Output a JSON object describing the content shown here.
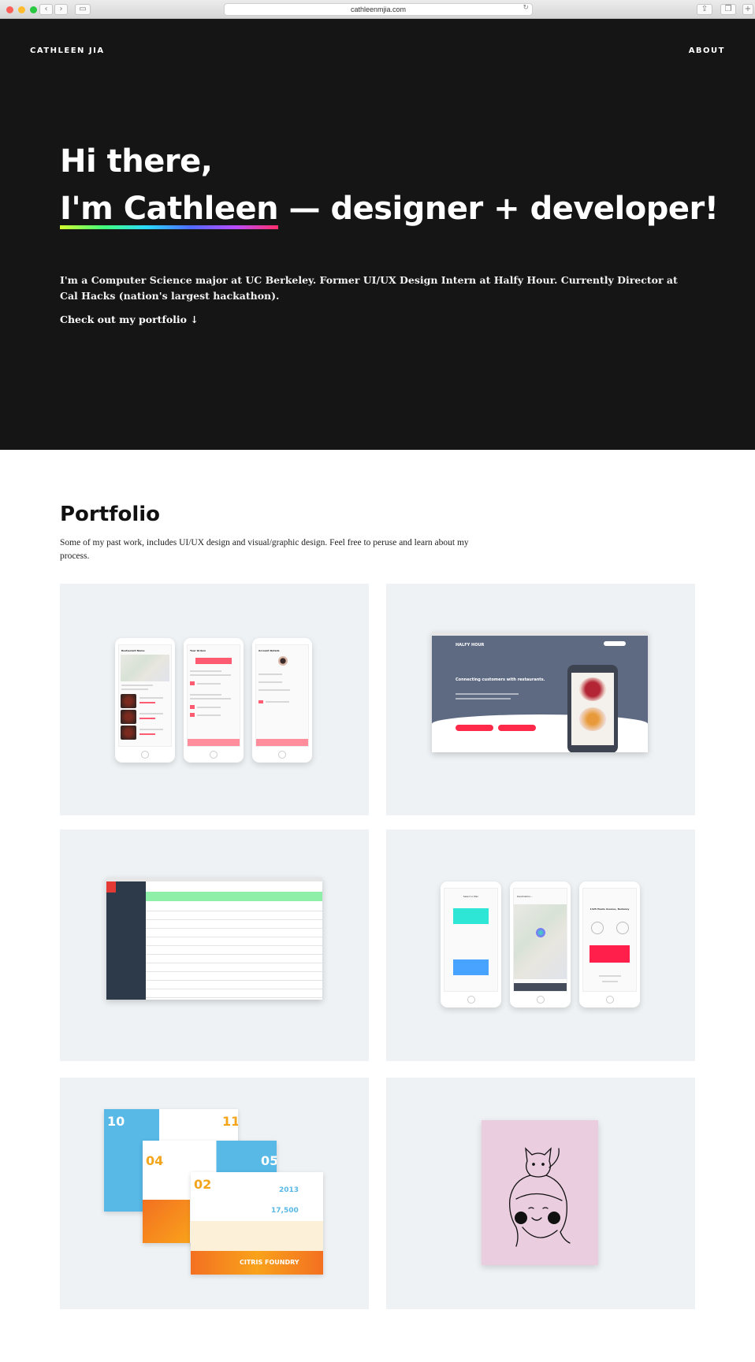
{
  "browser": {
    "url": "cathleenmjia.com"
  },
  "nav": {
    "brand": "CATHLEEN JIA",
    "about": "ABOUT"
  },
  "hero": {
    "greeting": "Hi there,",
    "name": "I'm Cathleen",
    "tagline": " — designer + developer!",
    "intro": "I'm a Computer Science major at UC Berkeley. Former UI/UX Design Intern at Halfy Hour. Currently Director at Cal Hacks (nation's largest hackathon).",
    "cta": "Check out my portfolio ↓"
  },
  "portfolio": {
    "title": "Portfolio",
    "description": "Some of my past work, includes UI/UX design and visual/graphic design. Feel free to peruse and learn about my process.",
    "items": [
      {
        "label": "Halfy Hour mobile app",
        "screens": [
          "Restaurant Name",
          "Your Orders",
          "Account Details"
        ]
      },
      {
        "label": "Halfy Hour website",
        "brand": "HALFY HOUR",
        "headline": "Connecting customers with restaurants."
      },
      {
        "label": "Dashboard table"
      },
      {
        "label": "Transport app",
        "screens": [
          "Select A Plan",
          "Destination...",
          "1325 Haste Avenue, Berkeley"
        ]
      },
      {
        "label": "CITRIS Foundry infographics",
        "brand": "CITRIS FOUNDRY"
      },
      {
        "label": "Cat illustration"
      }
    ]
  }
}
